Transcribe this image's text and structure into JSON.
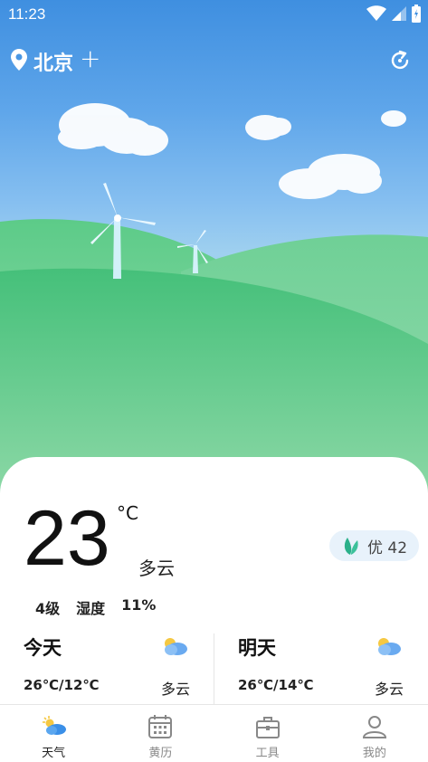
{
  "status_bar": {
    "time": "11:23"
  },
  "header": {
    "city": "北京",
    "add_label": "+"
  },
  "current": {
    "temperature": "23",
    "unit": "°C",
    "condition": "多云",
    "aqi": "优 42",
    "wind": "4级",
    "humidity_label": "湿度",
    "humidity_value": "11%"
  },
  "forecast": [
    {
      "day": "今天",
      "temp_range": "26℃/12℃",
      "condition": "多云",
      "icon": "partly-cloudy-icon"
    },
    {
      "day": "明天",
      "temp_range": "26℃/14℃",
      "condition": "多云",
      "icon": "partly-cloudy-icon"
    }
  ],
  "nav": [
    {
      "label": "天气",
      "icon": "weather-icon",
      "active": true
    },
    {
      "label": "黄历",
      "icon": "calendar-icon",
      "active": false
    },
    {
      "label": "工具",
      "icon": "toolbox-icon",
      "active": false
    },
    {
      "label": "我的",
      "icon": "profile-icon",
      "active": false
    }
  ],
  "colors": {
    "sky_top": "#3f8fe0",
    "grass": "#4cc27b",
    "aqi_leaf": "#2bb08a",
    "nav_active": "#3a8fe8"
  }
}
